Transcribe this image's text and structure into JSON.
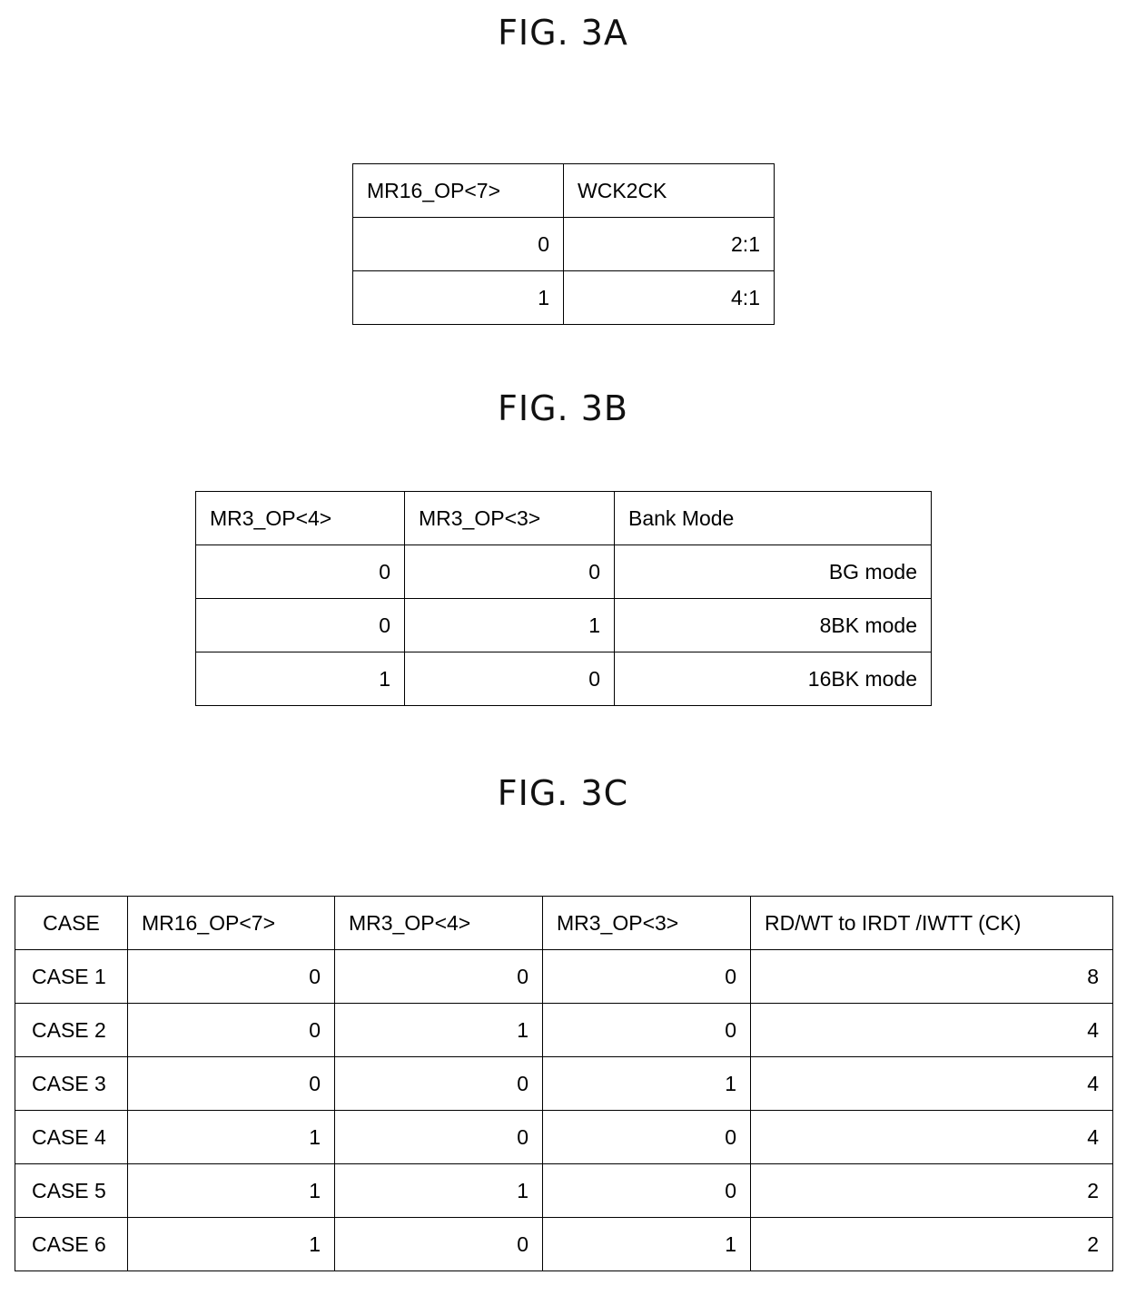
{
  "figures": [
    {
      "id": "3a",
      "title": "FIG. 3A",
      "headers": [
        "MR16_OP<7>",
        "WCK2CK"
      ],
      "rows": [
        [
          "0",
          "2:1"
        ],
        [
          "1",
          "4:1"
        ]
      ]
    },
    {
      "id": "3b",
      "title": "FIG. 3B",
      "headers": [
        "MR3_OP<4>",
        "MR3_OP<3>",
        "Bank Mode"
      ],
      "rows": [
        [
          "0",
          "0",
          "BG mode"
        ],
        [
          "0",
          "1",
          "8BK mode"
        ],
        [
          "1",
          "0",
          "16BK mode"
        ]
      ]
    },
    {
      "id": "3c",
      "title": "FIG. 3C",
      "headers": [
        "CASE",
        "MR16_OP<7>",
        "MR3_OP<4>",
        "MR3_OP<3>",
        "RD/WT to IRDT /IWTT (CK)"
      ],
      "rows": [
        [
          "CASE 1",
          "0",
          "0",
          "0",
          "8"
        ],
        [
          "CASE 2",
          "0",
          "1",
          "0",
          "4"
        ],
        [
          "CASE 3",
          "0",
          "0",
          "1",
          "4"
        ],
        [
          "CASE 4",
          "1",
          "0",
          "0",
          "4"
        ],
        [
          "CASE 5",
          "1",
          "1",
          "0",
          "2"
        ],
        [
          "CASE 6",
          "1",
          "0",
          "1",
          "2"
        ]
      ]
    }
  ]
}
